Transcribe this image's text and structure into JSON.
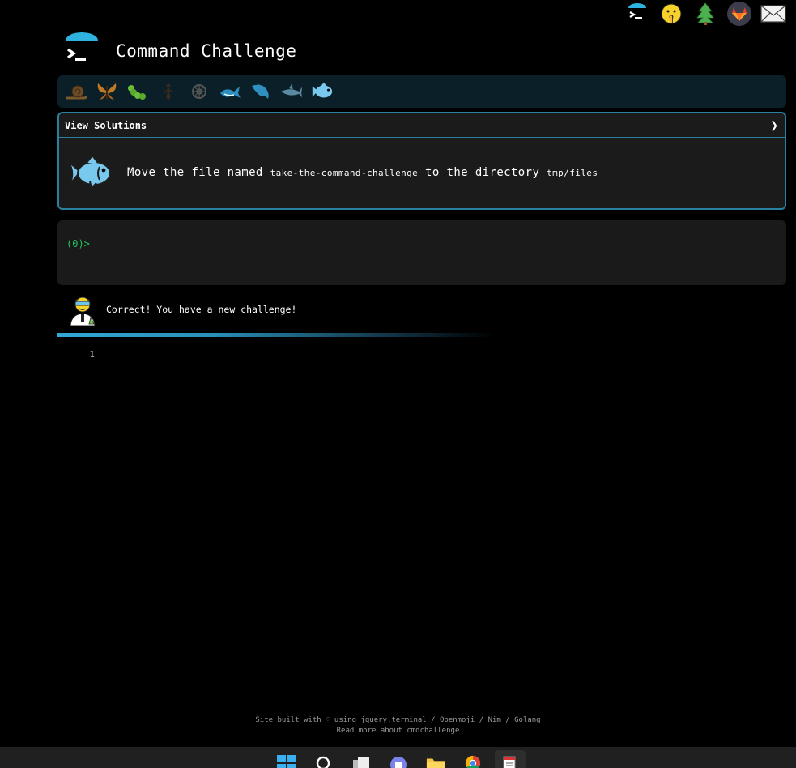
{
  "header": {
    "title": "Command Challenge"
  },
  "top_icons": [
    {
      "name": "terminal-logo-icon"
    },
    {
      "name": "shush-face-icon"
    },
    {
      "name": "tree-icon"
    },
    {
      "name": "gitlab-icon"
    },
    {
      "name": "mail-icon"
    }
  ],
  "challenge_icons": [
    "snail-icon",
    "butterfly-icon",
    "caterpillar-icon",
    "ant-icon",
    "wheel-icon",
    "whale-icon",
    "dolphin-icon",
    "shark-icon",
    "fish-icon"
  ],
  "task": {
    "view_solutions": "View Solutions",
    "chevron": "❯",
    "text_before": "Move the file named",
    "file": "take-the-command-challenge",
    "text_middle": "to the directory",
    "dir": "tmp/files"
  },
  "terminal": {
    "prompt": "(0)>"
  },
  "feedback": {
    "message": "Correct! You have a new challenge!"
  },
  "editor": {
    "line_number": "1"
  },
  "footer": {
    "line1": "Site built with ♡ using jquery.terminal / Openmoji / Nim / Golang",
    "line2": "Read more about cmdchallenge"
  },
  "colors": {
    "accent": "#2b7fa0",
    "prompt": "#22c55e",
    "bar": "#0a1f27"
  }
}
